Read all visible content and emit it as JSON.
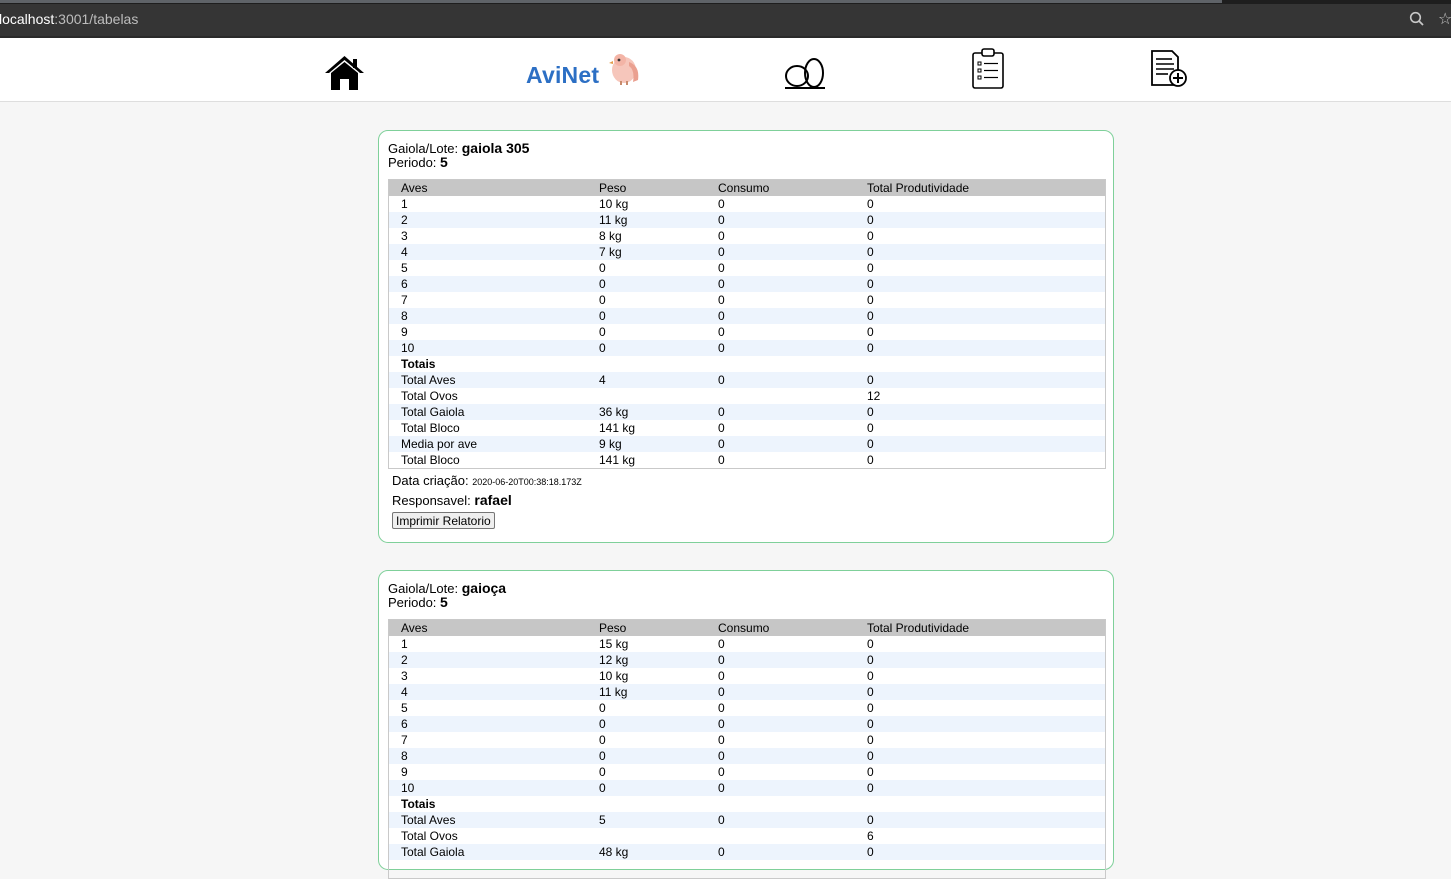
{
  "browser": {
    "url_host": "localhost",
    "url_rest": ":3001/tabelas"
  },
  "nav": {
    "brand": "AviNet",
    "items": [
      "home-icon",
      "eggs-icon",
      "clipboard-icon",
      "add-report-icon"
    ]
  },
  "colors": {
    "card_border": "#7fd09a",
    "brand": "#2c6fc4",
    "row_alt": "#edf4fd",
    "header_row": "#c6c6c6"
  },
  "labels": {
    "gaiola_lote": "Gaiola/Lote:",
    "periodo": "Periodo:",
    "data_criacao": "Data criação:",
    "responsavel": "Responsavel:",
    "print_button": "Imprimir Relatorio"
  },
  "columns": [
    "Aves",
    "Peso",
    "Consumo",
    "Total Produtividade"
  ],
  "cards": [
    {
      "gaiola": "gaiola 305",
      "periodo": "5",
      "rows": [
        [
          "1",
          "10 kg",
          "0",
          "0"
        ],
        [
          "2",
          "11 kg",
          "0",
          "0"
        ],
        [
          "3",
          "8 kg",
          "0",
          "0"
        ],
        [
          "4",
          "7 kg",
          "0",
          "0"
        ],
        [
          "5",
          "0",
          "0",
          "0"
        ],
        [
          "6",
          "0",
          "0",
          "0"
        ],
        [
          "7",
          "0",
          "0",
          "0"
        ],
        [
          "8",
          "0",
          "0",
          "0"
        ],
        [
          "9",
          "0",
          "0",
          "0"
        ],
        [
          "10",
          "0",
          "0",
          "0"
        ]
      ],
      "totais_label": "Totais",
      "totals": [
        [
          "Total Aves",
          "4",
          "0",
          "0"
        ],
        [
          "Total Ovos",
          "",
          "",
          "12"
        ],
        [
          "Total Gaiola",
          "36 kg",
          "0",
          "0"
        ],
        [
          "Total Bloco",
          "141 kg",
          "0",
          "0"
        ],
        [
          "Media por ave",
          "9 kg",
          "0",
          "0"
        ],
        [
          "Total Bloco",
          "141 kg",
          "0",
          "0"
        ]
      ],
      "data_criacao": "2020-06-20T00:38:18.173Z",
      "responsavel": "rafael"
    },
    {
      "gaiola": "gaioça",
      "periodo": "5",
      "rows": [
        [
          "1",
          "15 kg",
          "0",
          "0"
        ],
        [
          "2",
          "12 kg",
          "0",
          "0"
        ],
        [
          "3",
          "10 kg",
          "0",
          "0"
        ],
        [
          "4",
          "11 kg",
          "0",
          "0"
        ],
        [
          "5",
          "0",
          "0",
          "0"
        ],
        [
          "6",
          "0",
          "0",
          "0"
        ],
        [
          "7",
          "0",
          "0",
          "0"
        ],
        [
          "8",
          "0",
          "0",
          "0"
        ],
        [
          "9",
          "0",
          "0",
          "0"
        ],
        [
          "10",
          "0",
          "0",
          "0"
        ]
      ],
      "totais_label": "Totais",
      "totals": [
        [
          "Total Aves",
          "5",
          "0",
          "0"
        ],
        [
          "Total Ovos",
          "",
          "",
          "6"
        ],
        [
          "Total Gaiola",
          "48 kg",
          "0",
          "0"
        ]
      ]
    }
  ]
}
